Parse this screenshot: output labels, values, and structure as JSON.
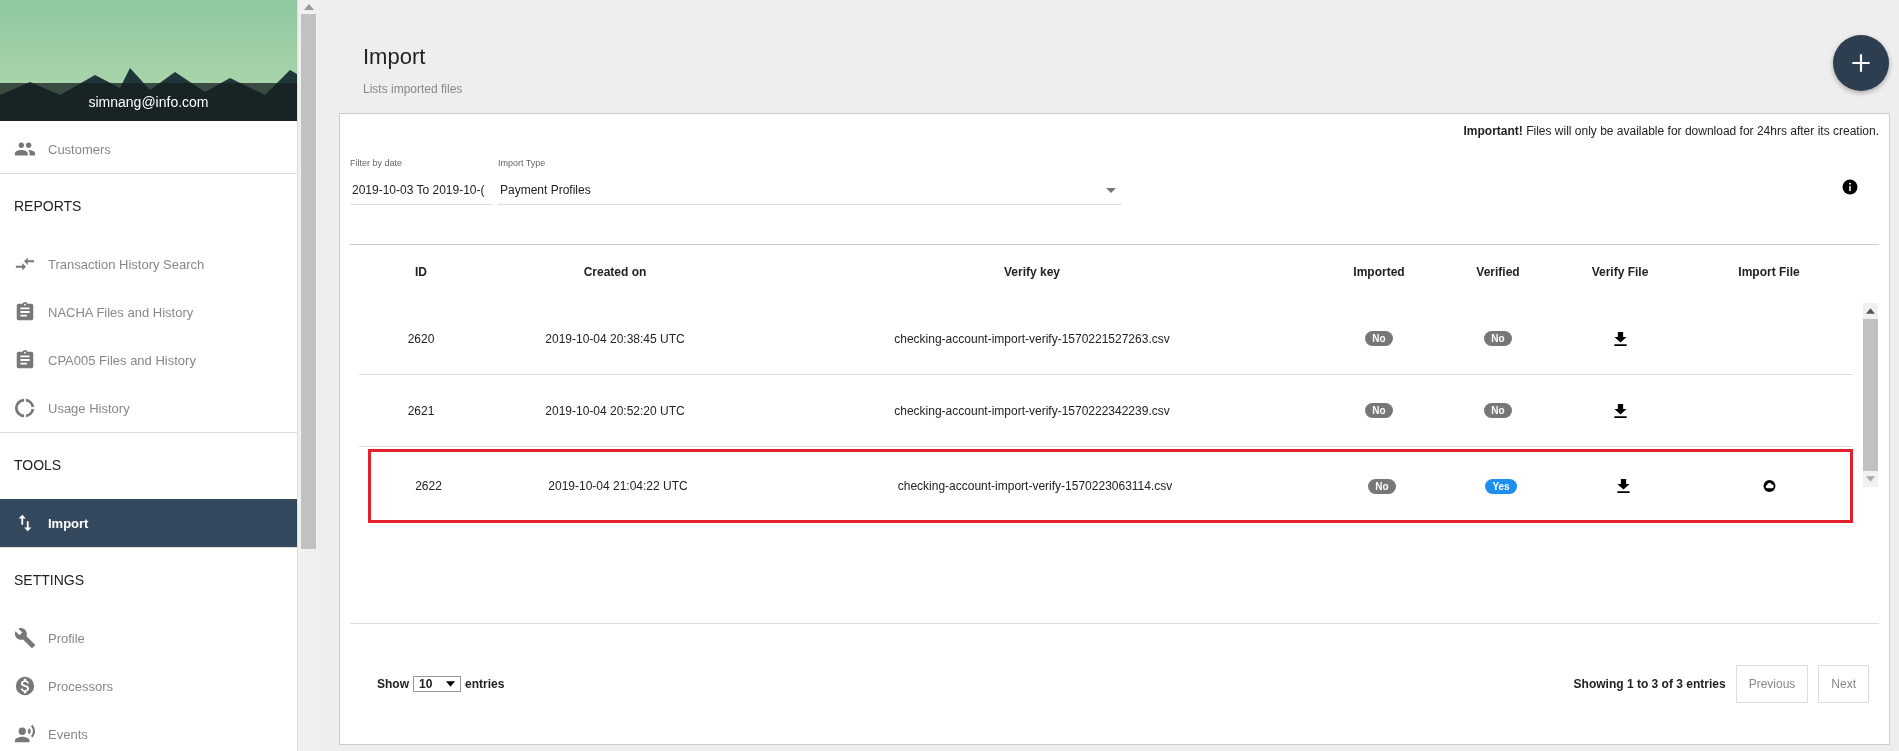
{
  "sidebar": {
    "user_email": "simnang@info.com",
    "sections": [
      {
        "items": [
          {
            "label": "Customers",
            "selected": false
          }
        ]
      },
      {
        "heading": "REPORTS",
        "items": [
          {
            "label": "Transaction History Search",
            "selected": false
          },
          {
            "label": "NACHA Files and History",
            "selected": false
          },
          {
            "label": "CPA005 Files and History",
            "selected": false
          },
          {
            "label": "Usage History",
            "selected": false
          }
        ]
      },
      {
        "heading": "TOOLS",
        "items": [
          {
            "label": "Import",
            "selected": true
          }
        ]
      },
      {
        "heading": "SETTINGS",
        "items": [
          {
            "label": "Profile",
            "selected": false
          },
          {
            "label": "Processors",
            "selected": false
          },
          {
            "label": "Events",
            "selected": false
          }
        ]
      }
    ]
  },
  "page": {
    "title": "Import",
    "subtitle": "Lists imported files"
  },
  "notice": "**Important!** Files will only be available for download for 24hrs after its creation.",
  "filters": [
    {
      "label": "Filter by date",
      "value": "2019-10-03 To 2019-10-(",
      "kind": "text"
    },
    {
      "label": "Import Type",
      "value": "Payment Profiles",
      "kind": "select"
    }
  ],
  "table": {
    "columns": [
      "ID",
      "Created on",
      "Verify key",
      "Imported",
      "Verified",
      "Verify File",
      "Import File"
    ],
    "rows": [
      {
        "id": "2620",
        "created_on": "2019-10-04 20:38:45 UTC",
        "verify_key": "checking-account-import-verify-1570221527263.csv",
        "imported": {
          "text": "No",
          "on": false
        },
        "verified": {
          "text": "No",
          "on": false
        },
        "verify_file": true,
        "import_file": false,
        "highlighted": false
      },
      {
        "id": "2621",
        "created_on": "2019-10-04 20:52:20 UTC",
        "verify_key": "checking-account-import-verify-1570222342239.csv",
        "imported": {
          "text": "No",
          "on": false
        },
        "verified": {
          "text": "No",
          "on": false
        },
        "verify_file": true,
        "import_file": false,
        "highlighted": false
      },
      {
        "id": "2622",
        "created_on": "2019-10-04 21:04:22 UTC",
        "verify_key": "checking-account-import-verify-1570223063114.csv",
        "imported": {
          "text": "No",
          "on": false
        },
        "verified": {
          "text": "Yes",
          "on": true
        },
        "verify_file": true,
        "import_file": true,
        "highlighted": true
      }
    ]
  },
  "footer": {
    "show_label": "Show",
    "page_size": "10",
    "entries_label": "entries",
    "summary": "Showing 1 to 3 of 3 entries",
    "buttons": [
      {
        "label": "Previous",
        "disabled": true
      },
      {
        "label": "Next",
        "disabled": true
      }
    ]
  }
}
